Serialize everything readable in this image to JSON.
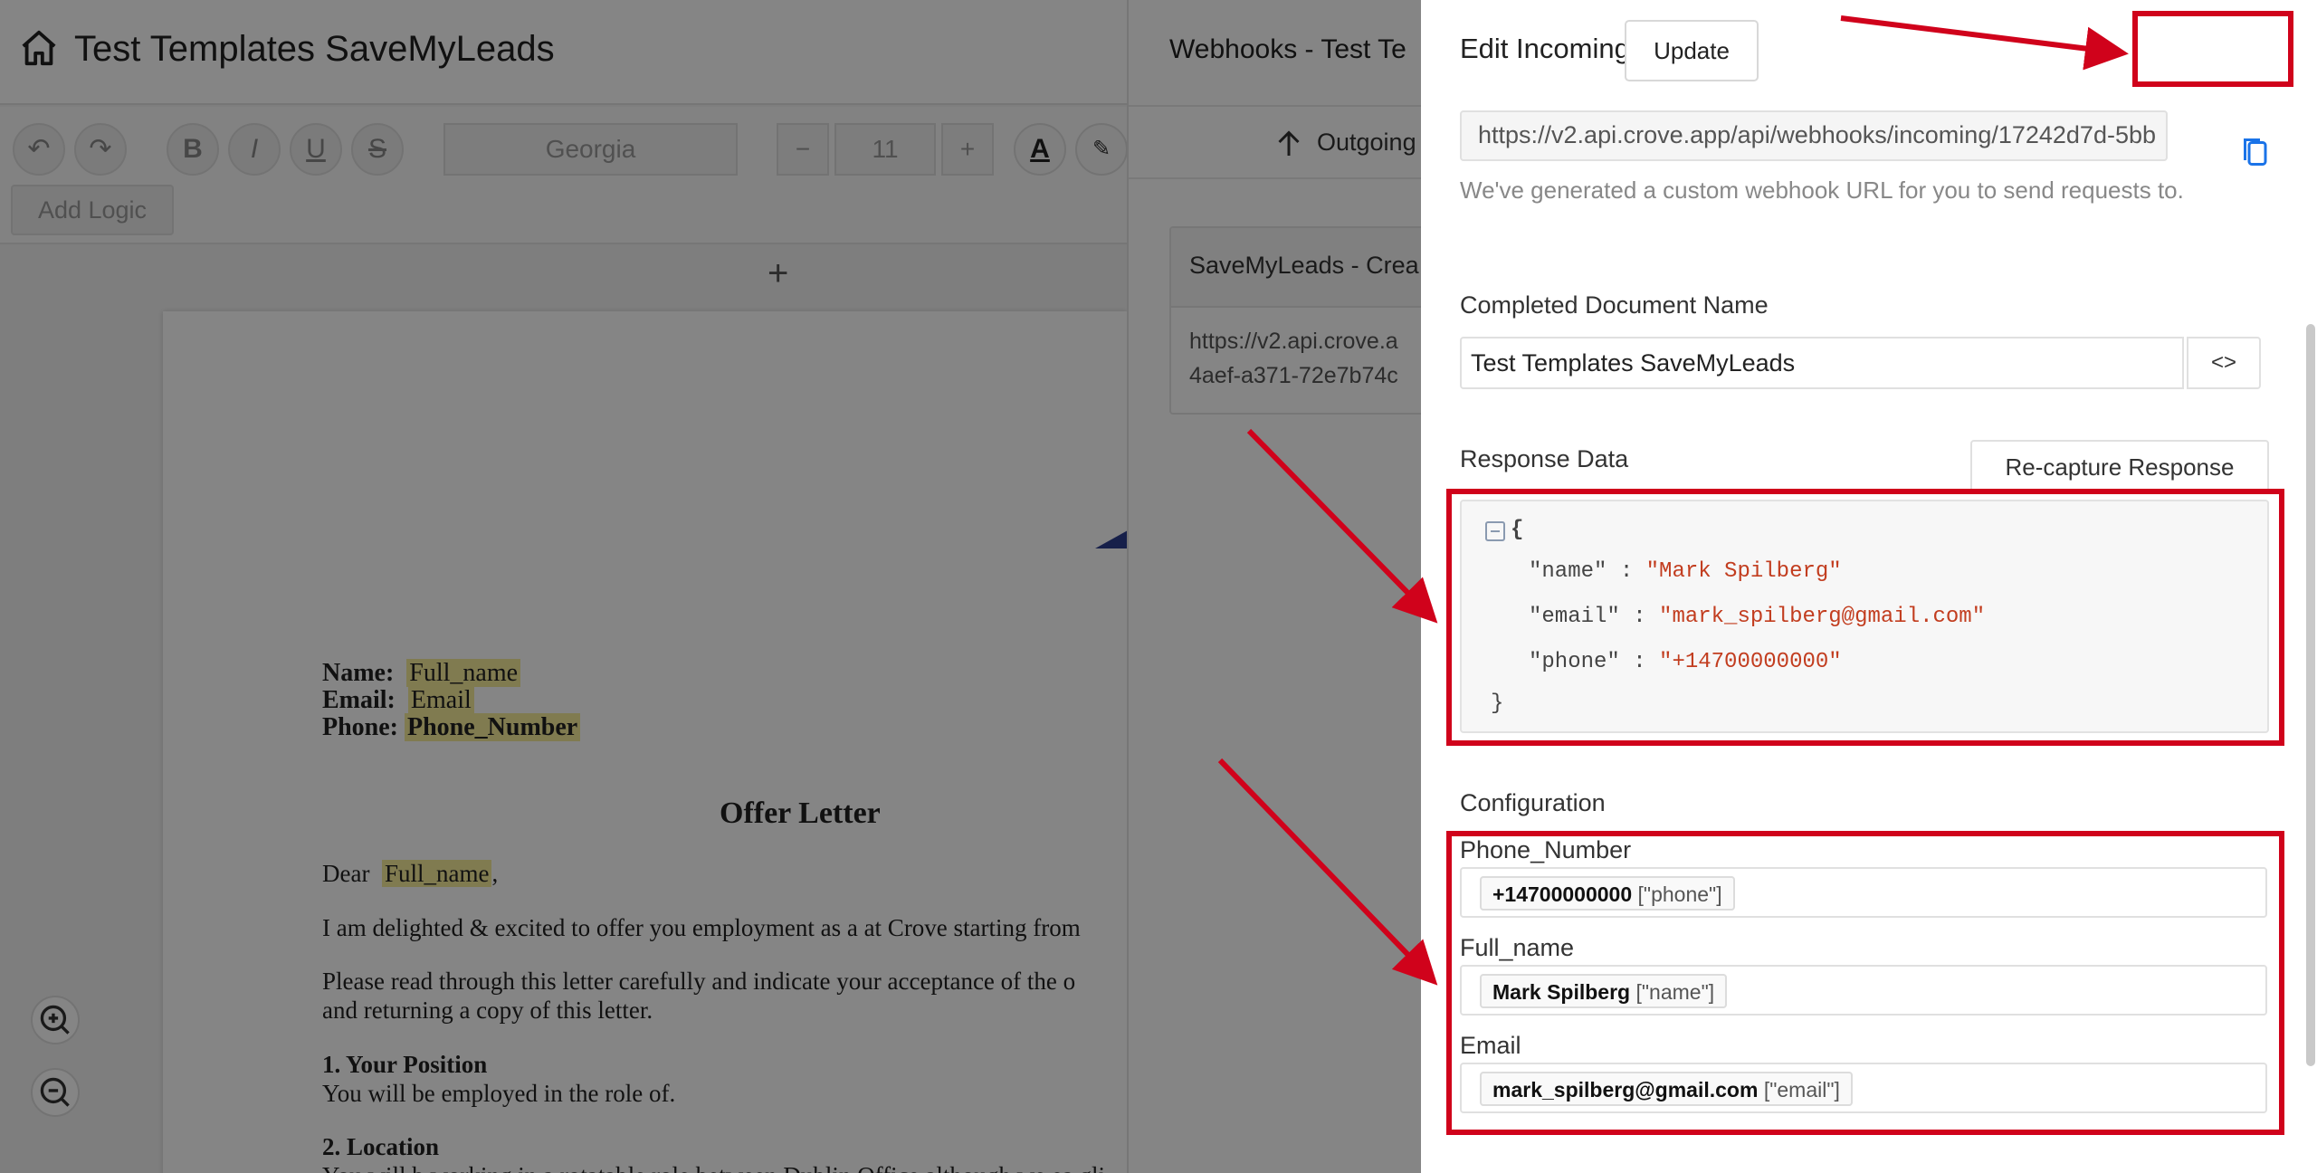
{
  "editor": {
    "title": "Test Templates SaveMyLeads",
    "font_name": "Georgia",
    "font_size": "11",
    "add_logic_label": "Add Logic",
    "plus_sign": "+",
    "document": {
      "fields": [
        {
          "label": "Name:",
          "value": "Full_name"
        },
        {
          "label": "Email:",
          "value": "Email"
        },
        {
          "label": "Phone:",
          "value": "Phone_Number"
        }
      ],
      "heading": "Offer Letter",
      "greeting_prefix": "Dear",
      "greeting_name": "Full_name",
      "greeting_suffix": ",",
      "paragraph1": "I am delighted & excited to offer you employment as a at Crove starting from",
      "paragraph2_line1": "Please read through this letter carefully and indicate your acceptance of the o",
      "paragraph2_line2": "and returning a copy of this letter.",
      "section1_title": "1. Your Position",
      "section1_text": "You will be employed in the role of.",
      "section2_title": "2. Location",
      "section2_text": "You will b    working in a rotatable role between Dublin Office    although we    ea    gli"
    }
  },
  "middle_panel": {
    "title": "Webhooks - Test Te",
    "tab_label": "Outgoing",
    "card_title": "SaveMyLeads - Crea",
    "card_url_line1": "https://v2.api.crove.a",
    "card_url_line2": "4aef-a371-72e7b74c"
  },
  "drawer": {
    "title": "Edit Incoming Webhook",
    "update_label": "Update",
    "webhook_url": "https://v2.api.crove.app/api/webhooks/incoming/17242d7d-5bb",
    "url_hint": "We've generated a custom webhook URL for you to send requests to.",
    "doc_name_label": "Completed Document Name",
    "doc_name_value": "Test Templates SaveMyLeads",
    "code_button_label": "<>",
    "response_label": "Response Data",
    "recapture_label": "Re-capture Response",
    "json_open": "{",
    "json_close": "}",
    "json_entries": [
      {
        "key": "\"name\"",
        "sep": " : ",
        "value": "\"Mark Spilberg\""
      },
      {
        "key": "\"email\"",
        "sep": " : ",
        "value": "\"mark_spilberg@gmail.com\""
      },
      {
        "key": "\"phone\"",
        "sep": " : ",
        "value": "\"+14700000000\""
      }
    ],
    "config_label": "Configuration",
    "config_fields": [
      {
        "label": "Phone_Number",
        "value": "+14700000000",
        "path": "[\"phone\"]"
      },
      {
        "label": "Full_name",
        "value": "Mark Spilberg",
        "path": "[\"name\"]"
      },
      {
        "label": "Email",
        "value": "mark_spilberg@gmail.com",
        "path": "[\"email\"]"
      }
    ]
  },
  "colors": {
    "annotation_red": "#d0021b",
    "json_value": "#c23d1f",
    "highlight": "#f5eb9a",
    "accent_blue": "#1a73e8"
  }
}
